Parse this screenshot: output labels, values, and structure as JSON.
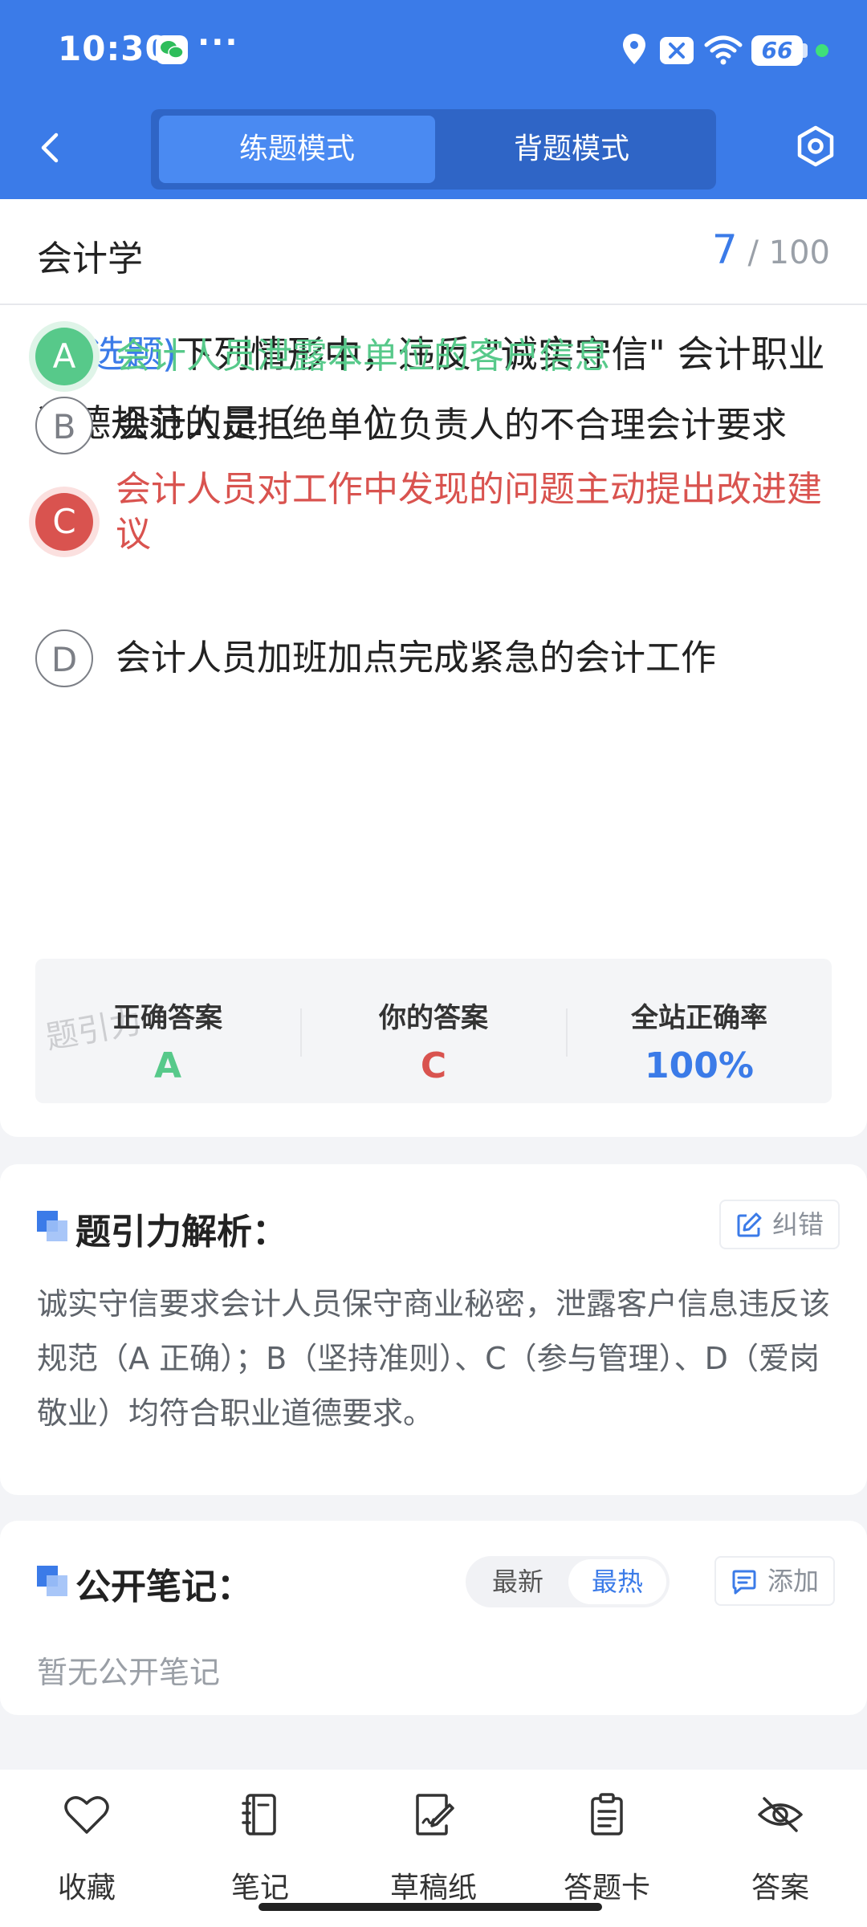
{
  "status_bar": {
    "time": "10:30",
    "dots": "···",
    "battery": "66"
  },
  "header": {
    "tabs": [
      {
        "label": "练题模式",
        "active": true
      },
      {
        "label": "背题模式",
        "active": false
      }
    ]
  },
  "subject": {
    "name": "会计学",
    "current": "7",
    "total": "/ 100"
  },
  "question": {
    "type": "(单选题)",
    "text": "下列情形中，违反 \"诚实守信\" 会计职业道德规范的是（　　）"
  },
  "options": [
    {
      "letter": "A",
      "text": "会计人员泄露本单位的客户信息",
      "state": "correct"
    },
    {
      "letter": "B",
      "text": "会计人员拒绝单位负责人的不合理会计要求",
      "state": "normal"
    },
    {
      "letter": "C",
      "text": "会计人员对工作中发现的问题主动提出改进建议",
      "state": "wrong"
    },
    {
      "letter": "D",
      "text": "会计人员加班加点完成紧急的会计工作",
      "state": "normal"
    }
  ],
  "answer_summary": {
    "correct_label": "正确答案",
    "correct_value": "A",
    "yours_label": "你的答案",
    "yours_value": "C",
    "rate_label": "全站正确率",
    "rate_value": "100%",
    "watermark": "题引力"
  },
  "analysis": {
    "title": "题引力解析：",
    "report_label": "纠错",
    "text": "诚实守信要求会计人员保守商业秘密，泄露客户信息违反该规范（A 正确）；B（坚持准则）、C（参与管理）、D（爱岗敬业）均符合职业道德要求。"
  },
  "notes": {
    "title": "公开笔记：",
    "sort_newest": "最新",
    "sort_hottest": "最热",
    "add_label": "添加",
    "empty_text": "暂无公开笔记"
  },
  "bottom_bar": {
    "items": [
      {
        "label": "收藏",
        "icon": "heart-icon"
      },
      {
        "label": "笔记",
        "icon": "notebook-icon"
      },
      {
        "label": "草稿纸",
        "icon": "draft-icon"
      },
      {
        "label": "答题卡",
        "icon": "answer-card-icon"
      },
      {
        "label": "答案",
        "icon": "eye-off-icon"
      }
    ]
  },
  "colors": {
    "primary": "#3b7be8",
    "correct": "#57c98a",
    "wrong": "#d9534f"
  }
}
